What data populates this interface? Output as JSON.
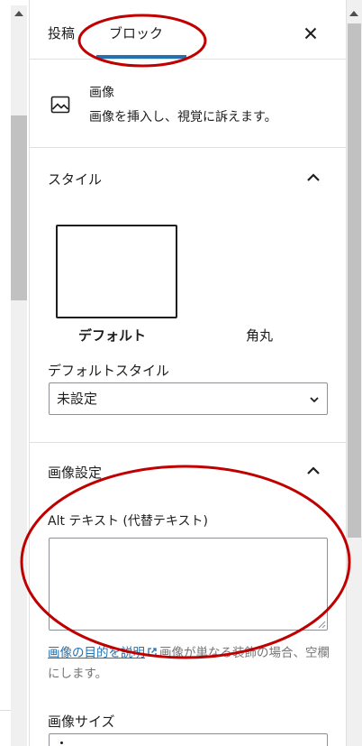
{
  "tabs": {
    "post_label": "投稿",
    "block_label": "ブロック"
  },
  "close_icon": "close-icon",
  "block_card": {
    "icon": "image-icon",
    "name": "画像",
    "description": "画像を挿入し、視覚に訴えます。"
  },
  "style_section": {
    "title": "スタイル",
    "styles": [
      "デフォルト",
      "角丸"
    ],
    "default_style_label": "デフォルトスタイル",
    "default_style_value": "未設定"
  },
  "image_settings": {
    "title": "画像設定",
    "alt_label": "Alt テキスト (代替テキスト)",
    "alt_value": "",
    "help_link": "画像の目的を説明",
    "help_text": "画像が単なる装飾の場合、空欄にします。",
    "size_label": "画像サイズ"
  },
  "colors": {
    "accent": "#2271b1",
    "annotation": "#c00000"
  }
}
